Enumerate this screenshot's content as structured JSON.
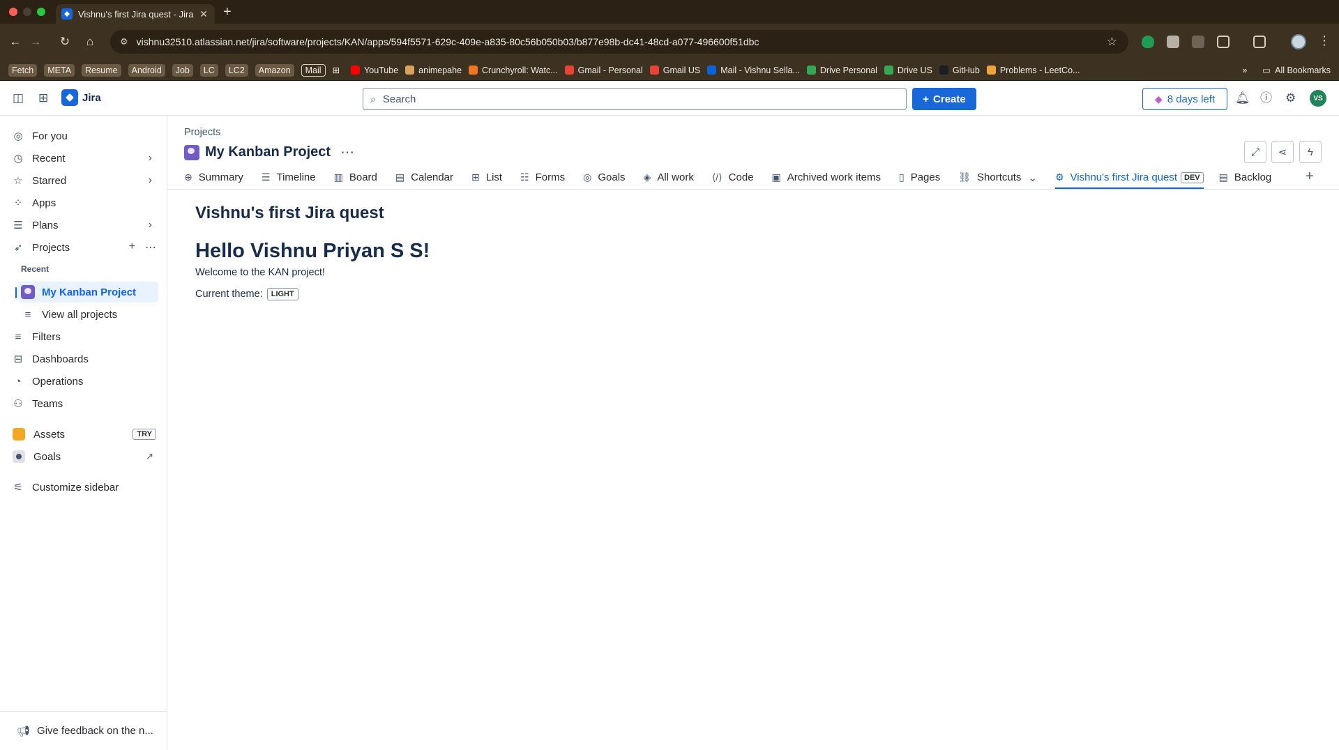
{
  "browser": {
    "tab_title": "Vishnu's first Jira quest - Jira",
    "url": "vishnu32510.atlassian.net/jira/software/projects/KAN/apps/594f5571-629c-409e-a835-80c56b050b03/b877e98b-dc41-48cd-a077-496600f51dbc",
    "bookmarks": [
      {
        "label": "Fetch",
        "style": "chip"
      },
      {
        "label": "META",
        "style": "chip"
      },
      {
        "label": "Resume",
        "style": "chip"
      },
      {
        "label": "Android",
        "style": "chip"
      },
      {
        "label": "Job",
        "style": "chip"
      },
      {
        "label": "LC",
        "style": "chip"
      },
      {
        "label": "LC2",
        "style": "chip"
      },
      {
        "label": "Amazon",
        "style": "chip"
      },
      {
        "label": "Mail",
        "style": "outlined"
      },
      {
        "label": "YouTube",
        "icon_color": "#ff0000"
      },
      {
        "label": "animepahe",
        "icon_color": "#d9a35c"
      },
      {
        "label": "Crunchyroll: Watc...",
        "icon_color": "#f47521"
      },
      {
        "label": "Gmail - Personal",
        "icon_color": "#ea4335"
      },
      {
        "label": "Gmail US",
        "icon_color": "#ea4335"
      },
      {
        "label": "Mail - Vishnu Sella...",
        "icon_color": "#0a64d8"
      },
      {
        "label": "Drive Personal",
        "icon_color": "#34a853"
      },
      {
        "label": "Drive US",
        "icon_color": "#34a853"
      },
      {
        "label": "GitHub",
        "icon_color": "#1b1f23"
      },
      {
        "label": "Problems - LeetCo...",
        "icon_color": "#f0a33a"
      }
    ],
    "all_bookmarks": "All Bookmarks"
  },
  "topnav": {
    "app_name": "Jira",
    "search_placeholder": "Search",
    "create_label": "Create",
    "trial_label": "8 days left",
    "avatar_initials": "VS"
  },
  "sidebar": {
    "items": [
      {
        "label": "For you"
      },
      {
        "label": "Recent"
      },
      {
        "label": "Starred"
      },
      {
        "label": "Apps"
      },
      {
        "label": "Plans"
      },
      {
        "label": "Projects"
      }
    ],
    "recent_label": "Recent",
    "project_item": "My Kanban Project",
    "view_all": "View all projects",
    "items2": [
      {
        "label": "Filters"
      },
      {
        "label": "Dashboards"
      },
      {
        "label": "Operations"
      },
      {
        "label": "Teams"
      }
    ],
    "assets": "Assets",
    "try_badge": "TRY",
    "goals": "Goals",
    "customize": "Customize sidebar",
    "feedback": "Give feedback on the n..."
  },
  "main": {
    "breadcrumb": "Projects",
    "project_title": "My Kanban Project",
    "tabs": [
      {
        "label": "Summary"
      },
      {
        "label": "Timeline"
      },
      {
        "label": "Board"
      },
      {
        "label": "Calendar"
      },
      {
        "label": "List"
      },
      {
        "label": "Forms"
      },
      {
        "label": "Goals"
      },
      {
        "label": "All work"
      },
      {
        "label": "Code"
      },
      {
        "label": "Archived work items"
      },
      {
        "label": "Pages"
      },
      {
        "label": "Shortcuts"
      },
      {
        "label": "Vishnu's first Jira quest"
      },
      {
        "label": "Backlog"
      }
    ],
    "dev_badge": "DEV",
    "app_title": "Vishnu's first Jira quest",
    "hello": "Hello Vishnu Priyan S S!",
    "welcome": "Welcome to the KAN project!",
    "theme_label": "Current theme:",
    "theme_value": "LIGHT"
  }
}
